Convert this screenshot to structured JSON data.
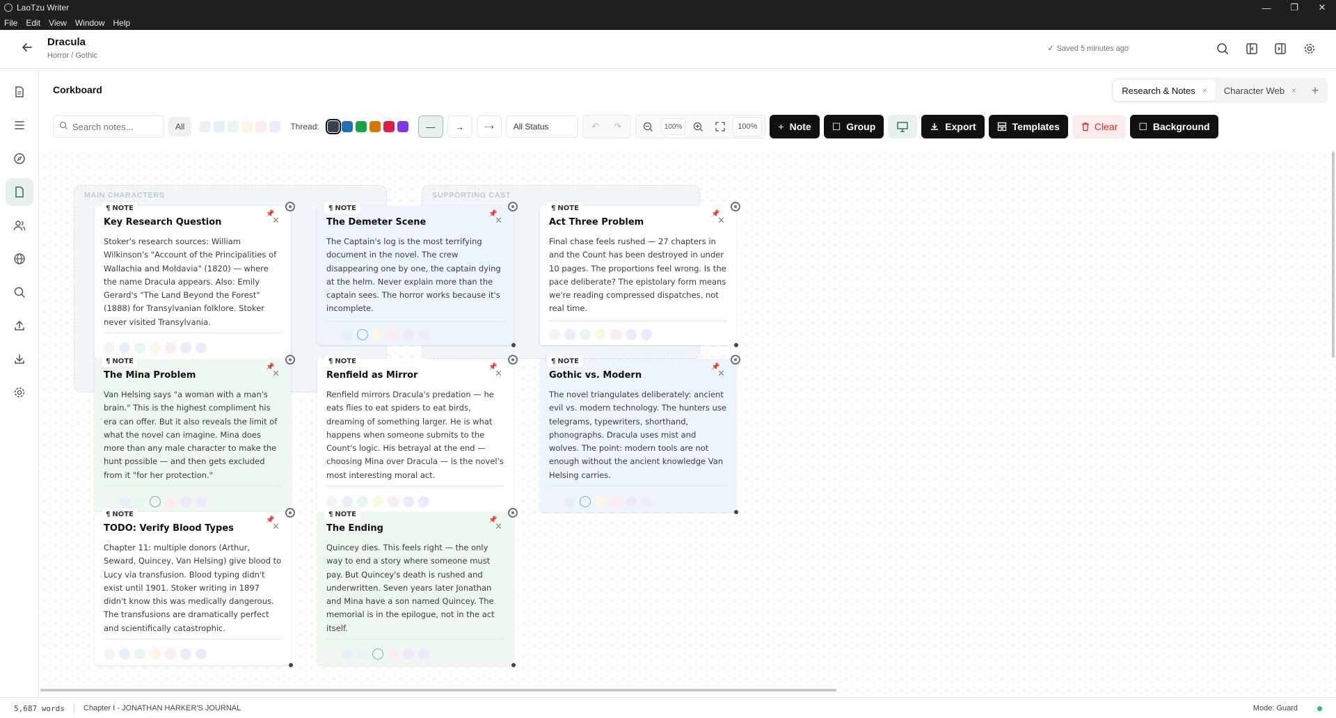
{
  "window": {
    "title": "LaoTzu Writer",
    "controls": [
      "—",
      "❐",
      "✕"
    ]
  },
  "menu": [
    "File",
    "Edit",
    "View",
    "Window",
    "Help"
  ],
  "header": {
    "title": "Dracula",
    "subtitle": "Horror / Gothic",
    "saved": "Saved 5 minutes ago"
  },
  "corkboard": {
    "title": "Corkboard"
  },
  "tabs": [
    {
      "label": "Research & Notes",
      "close": "×"
    },
    {
      "label": "Character Web",
      "close": "×"
    }
  ],
  "tab_add": "+",
  "toolbar": {
    "search_placeholder": "Search notes...",
    "filter_all": "All",
    "filter_swatches": [
      "#eef1f4",
      "#e6f0fa",
      "#e7f6ee",
      "#fdf6e3",
      "#fdecef",
      "#efeafb"
    ],
    "thread_label": "Thread:",
    "thread_colors": [
      "#374151",
      "#1d72b8",
      "#16a34a",
      "#d97706",
      "#e11d48",
      "#7c3aed"
    ],
    "line_solid": "—",
    "line_arrow": "→",
    "line_dashed": "⤍",
    "status_select": "All Status",
    "zoom_level_small": "100%",
    "zoom_pct": "100%",
    "note_btn": "Note",
    "group_btn": "Group",
    "export_btn": "Export",
    "templates_btn": "Templates",
    "clear_btn": "Clear",
    "background_btn": "Background"
  },
  "groups": [
    {
      "label": "MAIN CHARACTERS"
    },
    {
      "label": "SUPPORTING CAST"
    }
  ],
  "cards": [
    {
      "tag": "NOTE",
      "title": "Key Research Question",
      "color": "white",
      "body": "Stoker's research sources: William Wilkinson's \"Account of the Principalities of Wallachia and Moldavia\" (1820) — where the name Dracula appears. Also: Emily Gerard's \"The Land Beyond the Forest\" (1888) for Transylvanian folklore. Stoker never visited Transylvania."
    },
    {
      "tag": "NOTE",
      "title": "The Demeter Scene",
      "color": "blue",
      "body": "The Captain's log is the most terrifying document in the novel. The crew disappearing one by one, the captain dying at the helm. Never explain more than the captain sees. The horror works because it's incomplete."
    },
    {
      "tag": "NOTE",
      "title": "Act Three Problem",
      "color": "white",
      "body": "Final chase feels rushed — 27 chapters in and the Count has been destroyed in under 10 pages. The proportions feel wrong. Is the pace deliberate? The epistolary form means we're reading compressed dispatches, not real time."
    },
    {
      "tag": "NOTE",
      "title": "The Mina Problem",
      "color": "green",
      "body": "Van Helsing says \"a woman with a man's brain.\" This is the highest compliment his era can offer. But it also reveals the limit of what the novel can imagine. Mina does more than any male character to make the hunt possible — and then gets excluded from it \"for her protection.\""
    },
    {
      "tag": "NOTE",
      "title": "Renfield as Mirror",
      "color": "white",
      "body": "Renfield mirrors Dracula's predation — he eats flies to eat spiders to eat birds, dreaming of something larger. He is what happens when someone submits to the Count's logic. His betrayal at the end — choosing Mina over Dracula — is the novel's most interesting moral act."
    },
    {
      "tag": "NOTE",
      "title": "Gothic vs. Modern",
      "color": "blue",
      "body": "The novel triangulates deliberately: ancient evil vs. modern technology. The hunters use telegrams, typewriters, shorthand, phonographs. Dracula uses mist and wolves. The point: modern tools are not enough without the ancient knowledge Van Helsing carries."
    },
    {
      "tag": "NOTE",
      "title": "TODO: Verify Blood Types",
      "color": "white",
      "body": "Chapter 11: multiple donors (Arthur, Seward, Quincey, Van Helsing) give blood to Lucy via transfusion. Blood typing didn't exist until 1901. Stoker writing in 1897 didn't know this was medically dangerous. The transfusions are dramatically perfect and scientifically catastrophic."
    },
    {
      "tag": "NOTE",
      "title": "The Ending",
      "color": "green",
      "body": "Quincey dies. This feels right — the only way to end a story where someone must pay. But Quincey's death is rushed and underwritten. Seven years later Jonathan and Mina have a son named Quincey. The memorial is in the epilogue, not in the act itself."
    }
  ],
  "statusbar": {
    "words": "5,687 words",
    "chapter": "Chapter I - JONATHAN HARKER'S JOURNAL",
    "mode": "Mode: Guard"
  }
}
